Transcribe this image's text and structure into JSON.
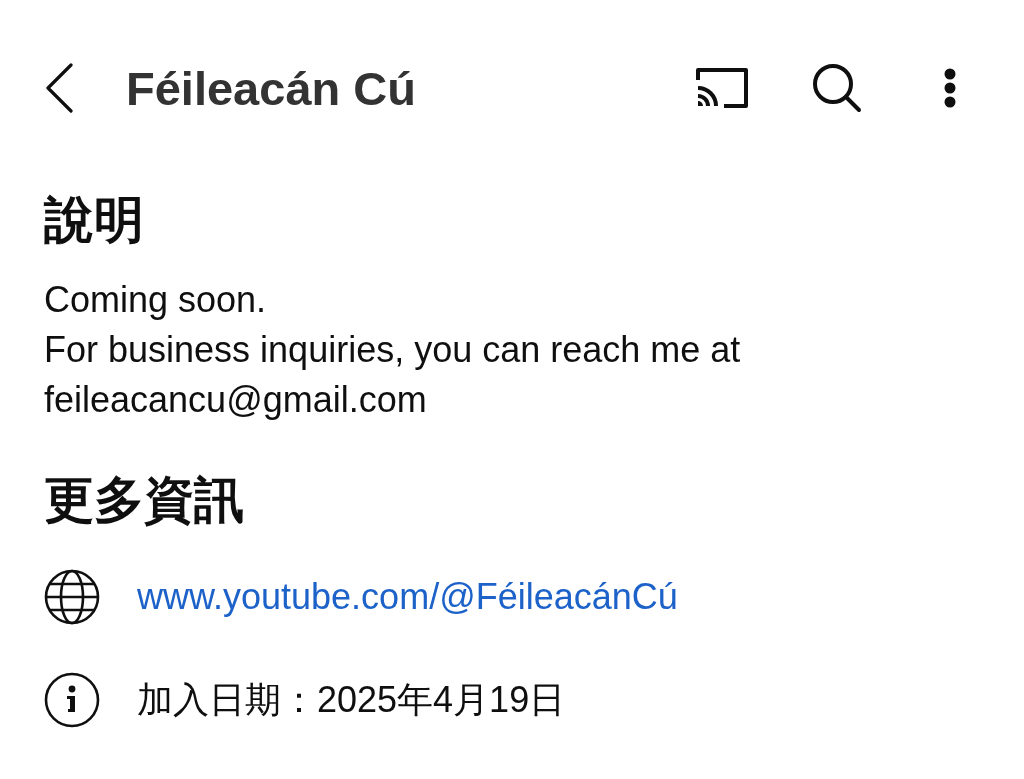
{
  "header": {
    "title": "Féileacán Cú"
  },
  "description": {
    "heading": "說明",
    "text": "Coming soon.\nFor business inquiries, you can reach me at\nfeileacancu@gmail.com"
  },
  "more_info": {
    "heading": "更多資訊",
    "items": [
      {
        "kind": "link",
        "text": "www.youtube.com/@FéileacánCú"
      },
      {
        "kind": "joined",
        "text": "加入日期：2025年4月19日"
      }
    ]
  }
}
